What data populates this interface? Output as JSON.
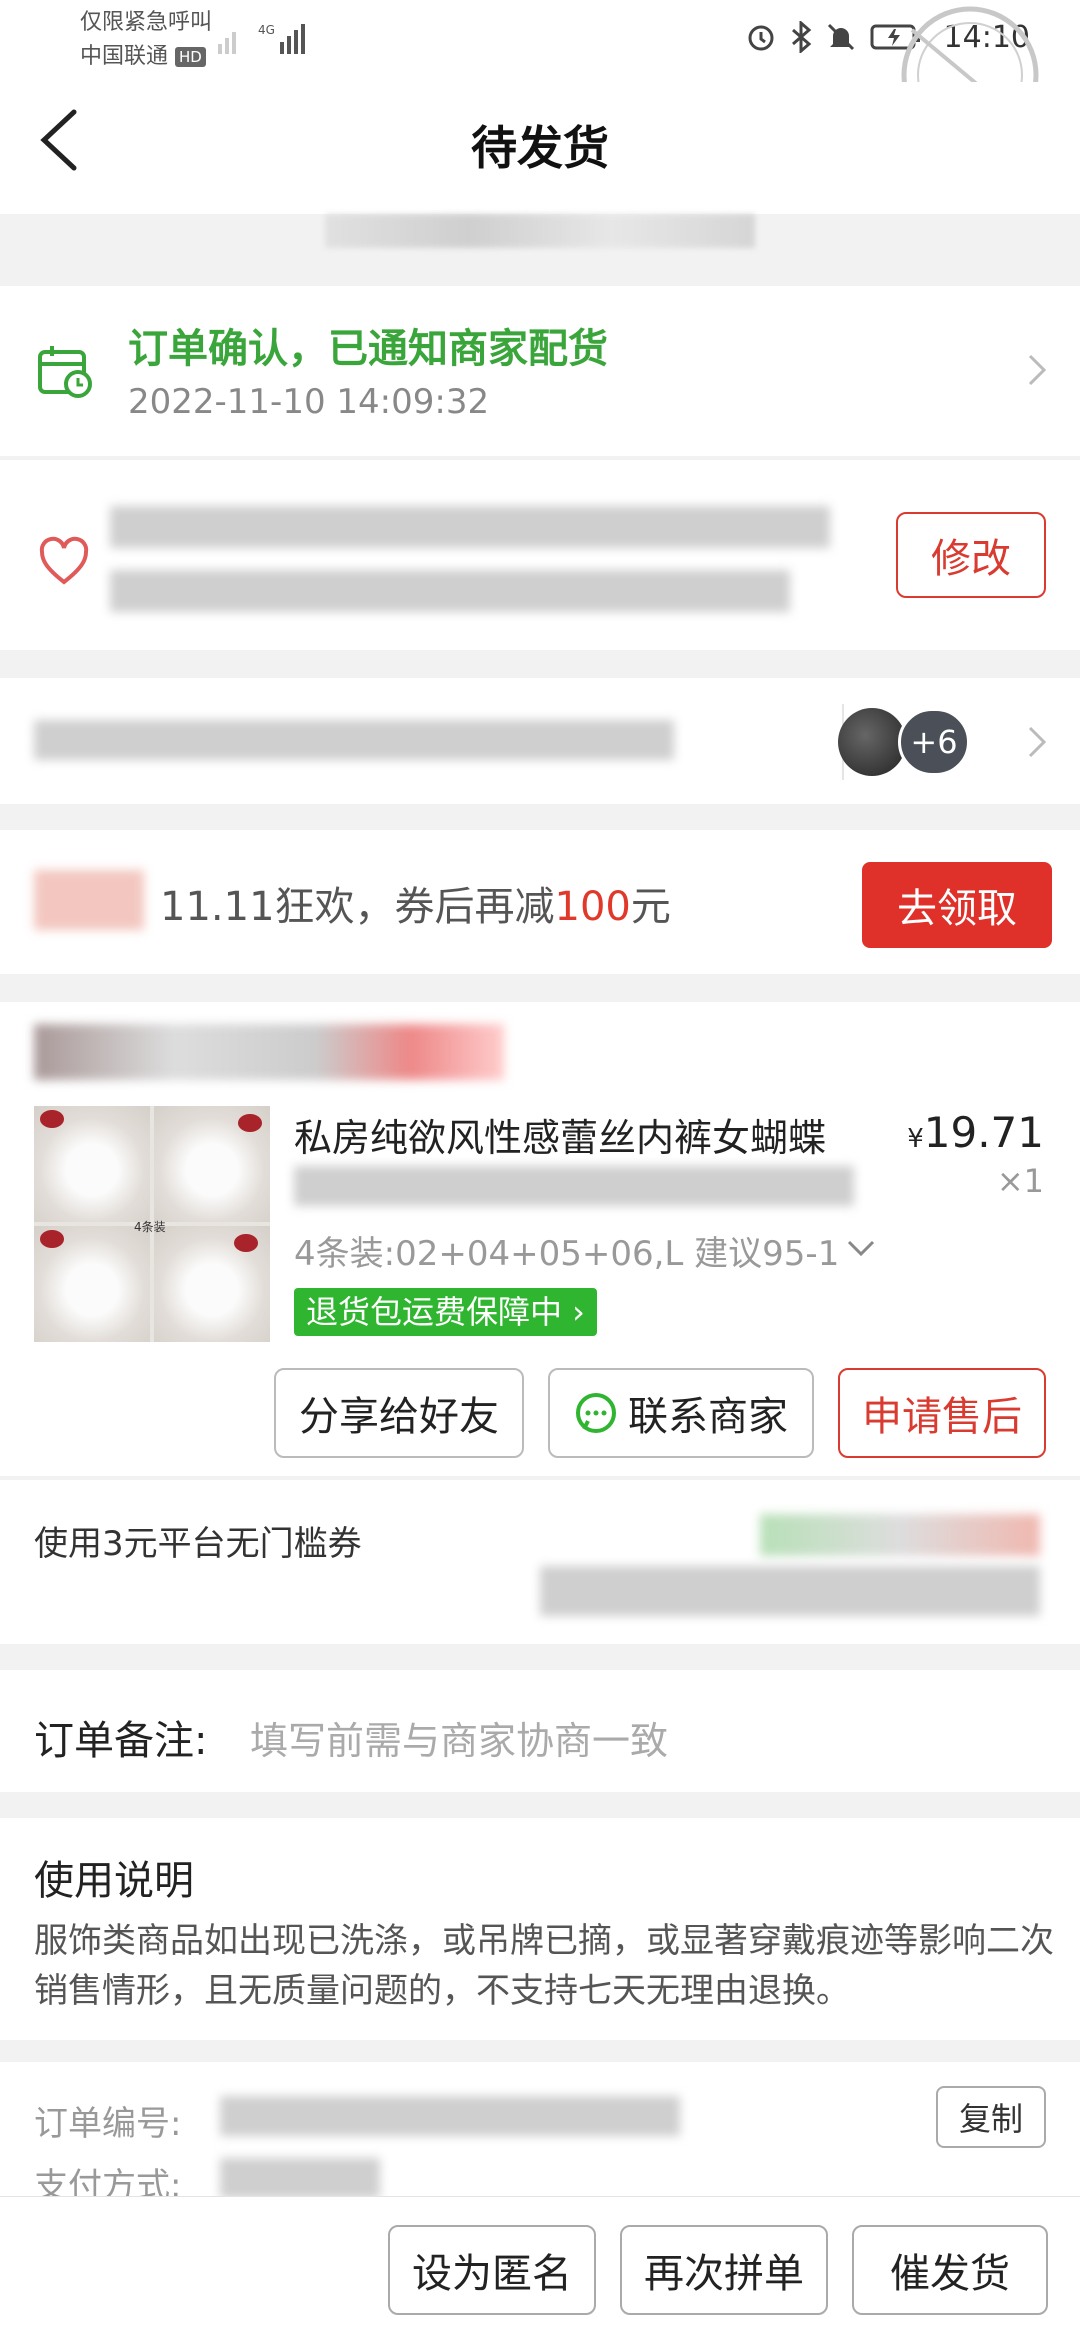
{
  "status_bar": {
    "carrier_line1": "仅限紧急呼叫",
    "carrier_line2": "中国联通",
    "hd_badge": "HD",
    "network": "4G",
    "time": "14:10"
  },
  "header": {
    "title": "待发货"
  },
  "order_status": {
    "text": "订单确认，已通知商家配货",
    "time": "2022-11-10 14:09:32"
  },
  "address": {
    "modify_label": "修改"
  },
  "group": {
    "extra_count": "+6"
  },
  "promo": {
    "text_prefix": "11.11狂欢，券后再减",
    "amount": "100",
    "unit": "元",
    "claim_label": "去领取"
  },
  "product": {
    "title": "私房纯欲风性感蕾丝内裤女蝴蝶",
    "image_tag": "4条装",
    "price_symbol": "¥",
    "price": "19.71",
    "quantity": "×1",
    "spec": "4条装:02+04+05+06,L 建议95-1",
    "guarantee": "退货包运费保障中 ›",
    "share_label": "分享给好友",
    "contact_label": "联系商家",
    "aftersale_label": "申请售后"
  },
  "coupon": {
    "label": "使用3元平台无门槛券"
  },
  "remark": {
    "label": "订单备注:",
    "placeholder": "填写前需与商家协商一致"
  },
  "usage": {
    "title": "使用说明",
    "body": "服饰类商品如出现已洗涤，或吊牌已摘，或显著穿戴痕迹等影响二次销售情形，且无质量问题的，不支持七天无理由退换。"
  },
  "order_info": {
    "order_no_label": "订单编号:",
    "pay_method_label": "支付方式:",
    "copy_label": "复制"
  },
  "bottom_bar": {
    "anonymous_label": "设为匿名",
    "regroup_label": "再次拼单",
    "urge_label": "催发货"
  },
  "colors": {
    "accent_red": "#e0302a",
    "status_green": "#3aa53a",
    "guarantee_green": "#2fb52f"
  },
  "icons": [
    "back-arrow-icon",
    "calendar-clock-icon",
    "location-heart-icon",
    "chevron-right-icon",
    "chat-bubble-icon",
    "chevron-down-icon",
    "alarm-icon",
    "bluetooth-icon",
    "mute-bell-icon",
    "battery-icon"
  ]
}
